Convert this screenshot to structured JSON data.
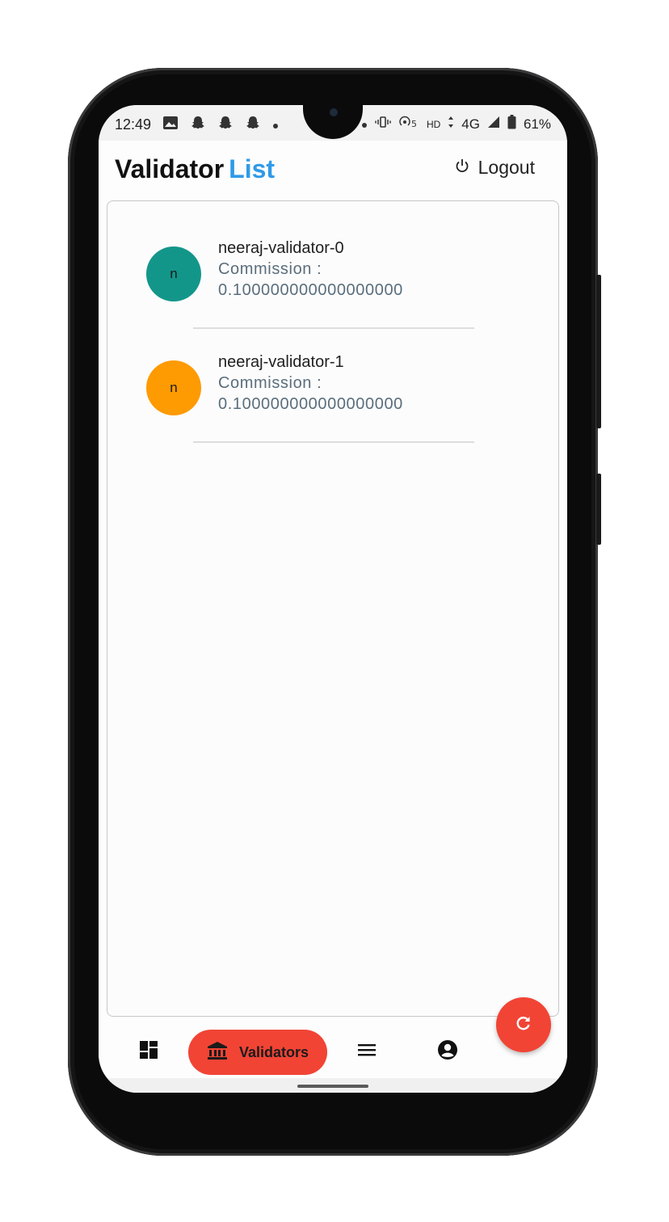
{
  "status_bar": {
    "time": "12:49",
    "network_label": "HD",
    "signal_label": "4G",
    "battery_percent": "61%",
    "left_icons": [
      "image-icon",
      "snapchat-icon",
      "snapchat-icon",
      "snapchat-icon",
      "dot-icon"
    ],
    "right_icons": [
      "dot-icon",
      "vibrate-icon",
      "hotspot-icon",
      "signal-icon",
      "battery-icon"
    ]
  },
  "header": {
    "title_main": "Validator",
    "title_accent": "List",
    "logout_label": "Logout",
    "accent_color": "#2f9ae9"
  },
  "validators": [
    {
      "initial": "n",
      "name": "neeraj-validator-0",
      "commission_label": "Commission :",
      "commission_value": "0.100000000000000000",
      "avatar_color": "#13968a"
    },
    {
      "initial": "n",
      "name": "neeraj-validator-1",
      "commission_label": "Commission :",
      "commission_value": "0.100000000000000000",
      "avatar_color": "#fe9a02"
    }
  ],
  "bottom_nav": {
    "items": [
      {
        "icon": "dashboard-icon",
        "label": ""
      },
      {
        "icon": "bank-icon",
        "label": "Validators",
        "active": true
      },
      {
        "icon": "menu-icon",
        "label": ""
      },
      {
        "icon": "account-circle-icon",
        "label": ""
      }
    ],
    "active_color": "#f14435"
  },
  "fab": {
    "icon": "refresh-icon",
    "color": "#f14435"
  }
}
